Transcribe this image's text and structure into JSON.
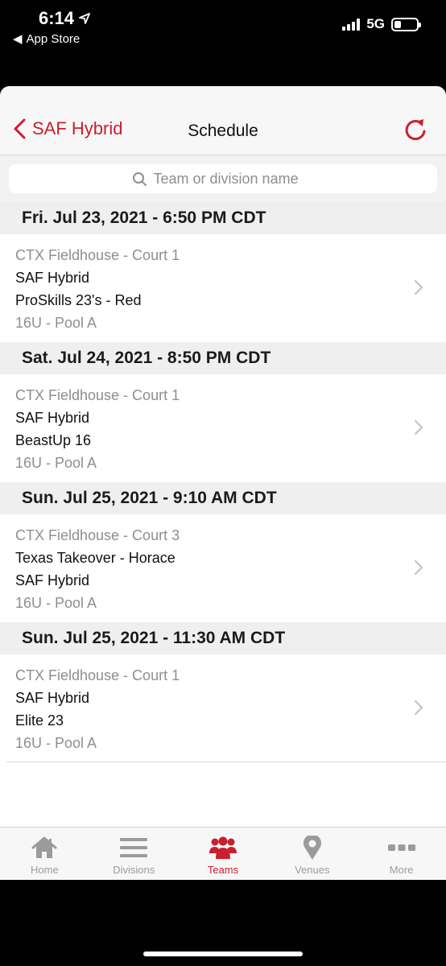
{
  "status_bar": {
    "time": "6:14",
    "back_app": "App Store",
    "network": "5G"
  },
  "nav": {
    "back_label": "SAF Hybrid",
    "title": "Schedule"
  },
  "search": {
    "placeholder": "Team or division name"
  },
  "schedule": [
    {
      "date": "Fri. Jul 23, 2021 - 6:50 PM CDT",
      "venue": "CTX Fieldhouse - Court 1",
      "team1": "SAF Hybrid",
      "team2": "ProSkills 23's - Red",
      "pool": "16U - Pool A"
    },
    {
      "date": "Sat. Jul 24, 2021 - 8:50 PM CDT",
      "venue": "CTX Fieldhouse - Court 1",
      "team1": "SAF Hybrid",
      "team2": "BeastUp 16",
      "pool": "16U - Pool A"
    },
    {
      "date": "Sun. Jul 25, 2021 - 9:10 AM CDT",
      "venue": "CTX Fieldhouse - Court 3",
      "team1": "Texas Takeover - Horace",
      "team2": "SAF Hybrid",
      "pool": "16U - Pool A"
    },
    {
      "date": "Sun. Jul 25, 2021 - 11:30 AM CDT",
      "venue": "CTX Fieldhouse - Court 1",
      "team1": "SAF Hybrid",
      "team2": "Elite 23",
      "pool": "16U - Pool A"
    }
  ],
  "tabs": [
    {
      "label": "Home",
      "icon": "home-icon",
      "active": false
    },
    {
      "label": "Divisions",
      "icon": "list-icon",
      "active": false
    },
    {
      "label": "Teams",
      "icon": "people-icon",
      "active": true
    },
    {
      "label": "Venues",
      "icon": "map-pin-icon",
      "active": false
    },
    {
      "label": "More",
      "icon": "more-dots-icon",
      "active": false
    }
  ],
  "colors": {
    "accent": "#c8202f",
    "inactive": "#9b9b9b"
  }
}
